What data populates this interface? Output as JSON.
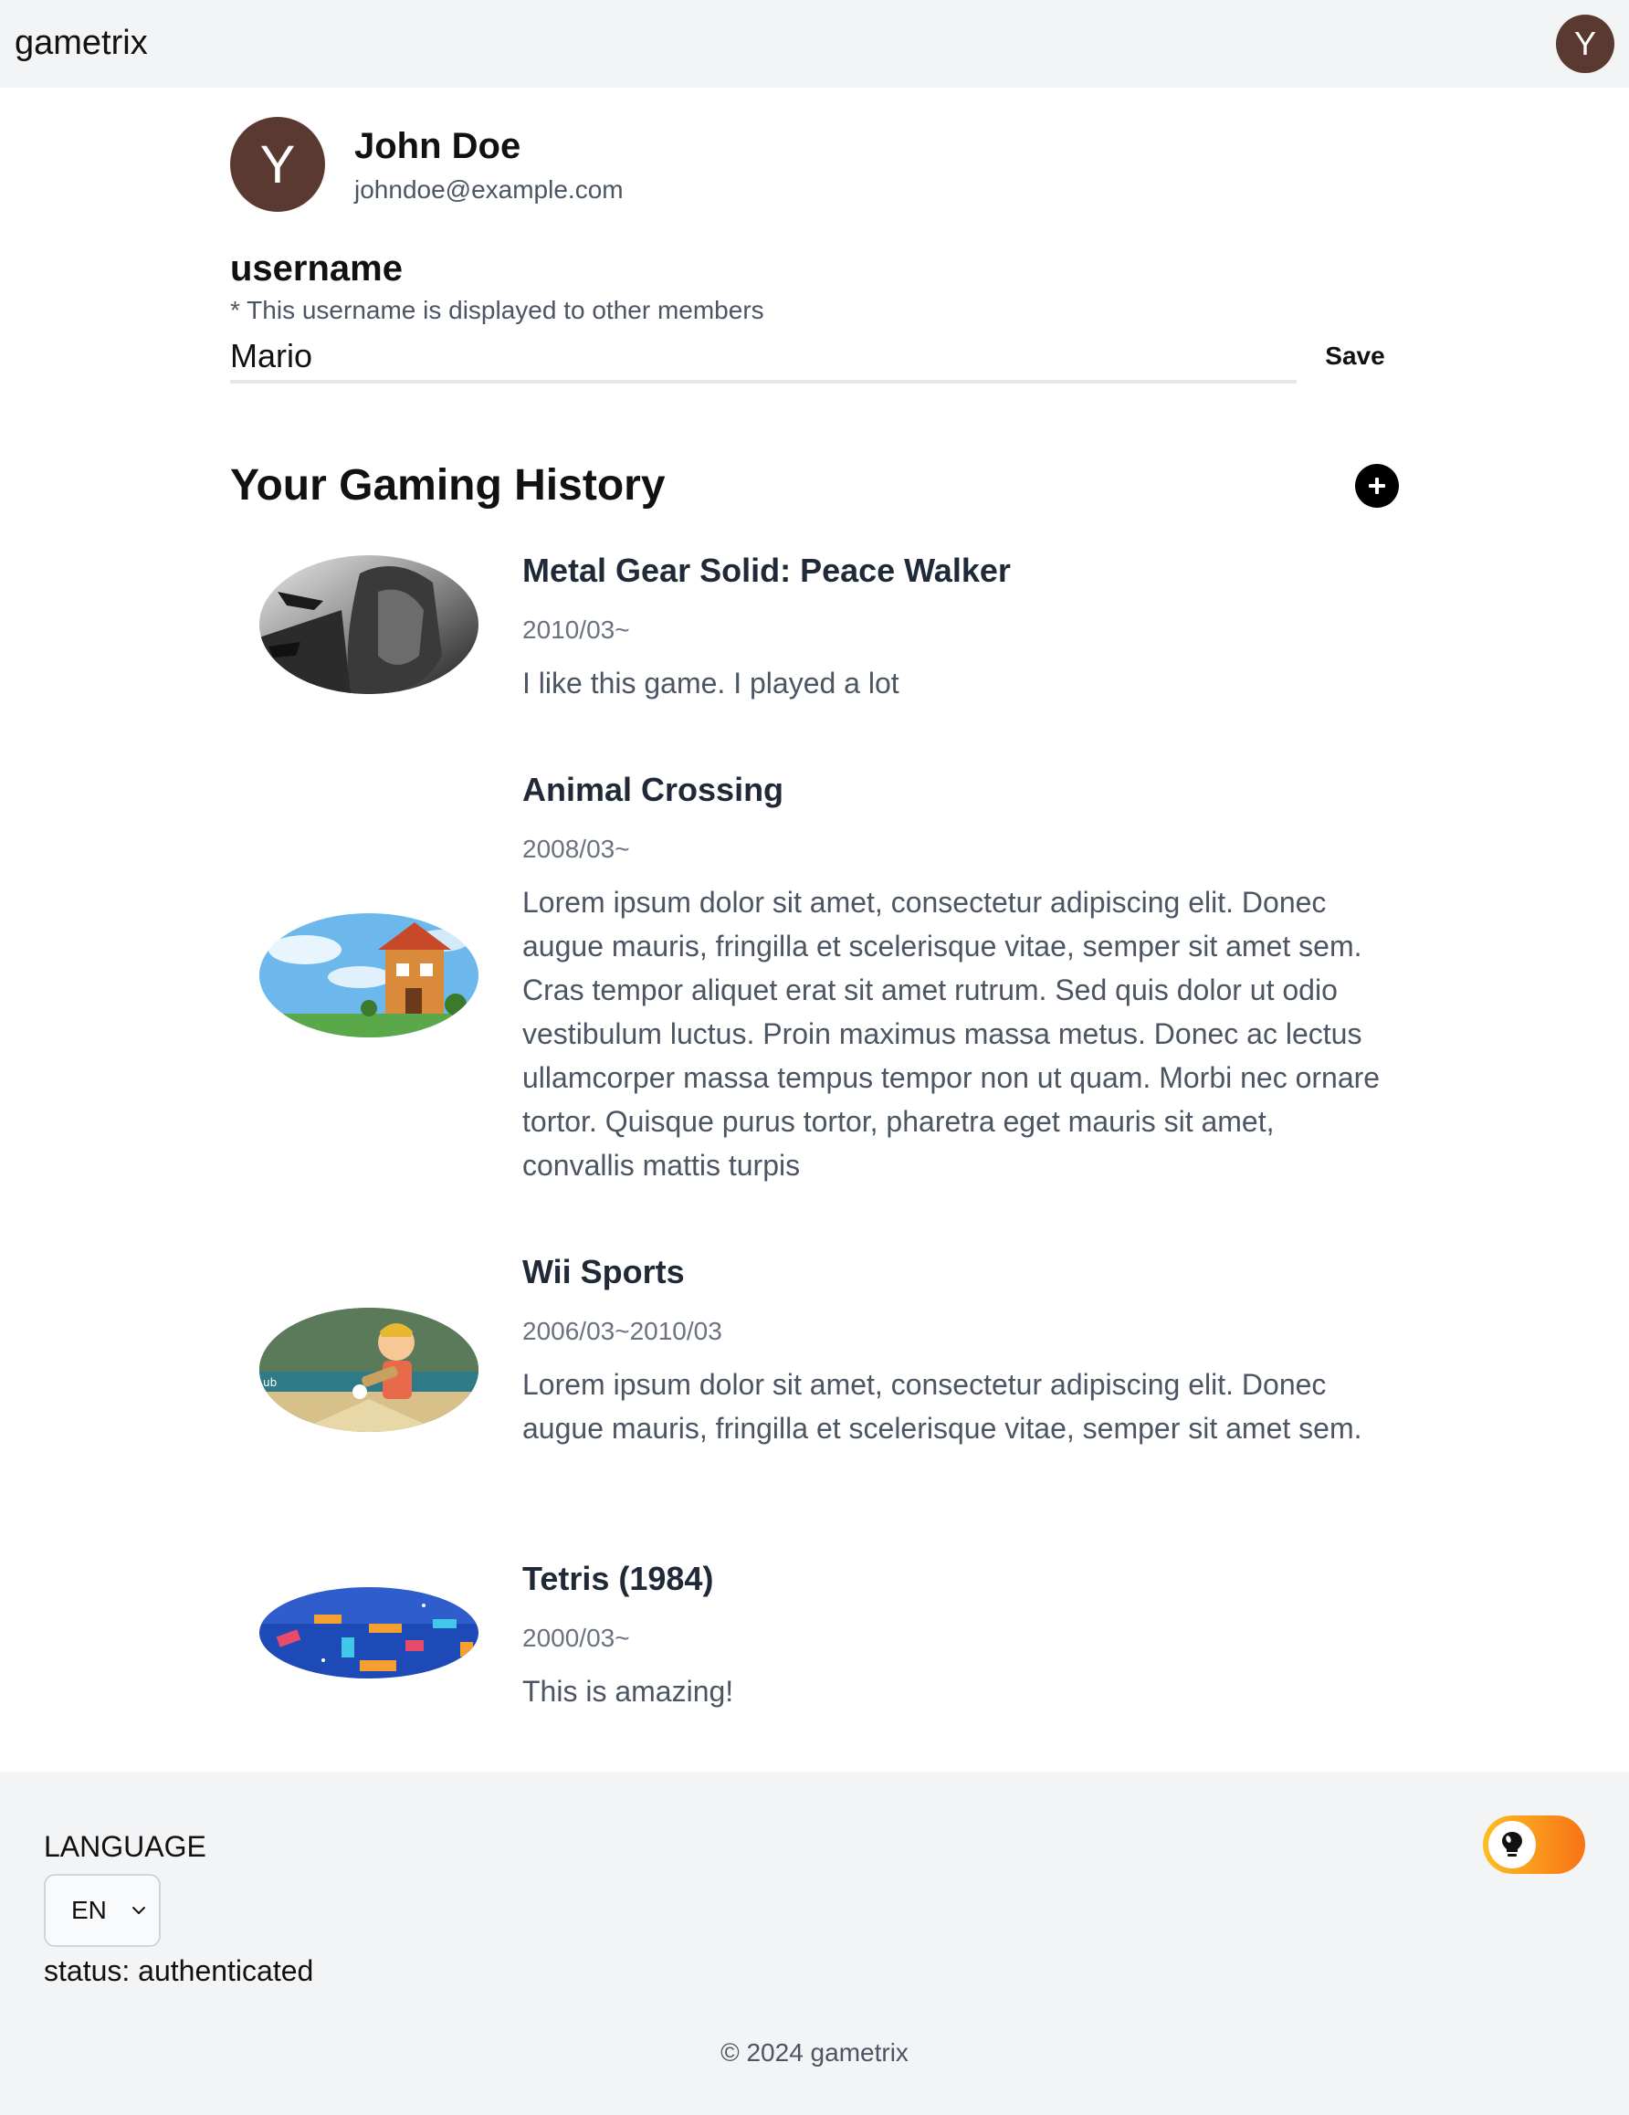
{
  "header": {
    "brand": "gametrix",
    "avatar_letter": "Y"
  },
  "profile": {
    "avatar_letter": "Y",
    "name": "John Doe",
    "email": "johndoe@example.com"
  },
  "username": {
    "heading": "username",
    "note": "* This username is displayed to other members",
    "value": "Mario",
    "save_label": "Save"
  },
  "history": {
    "title": "Your Gaming History",
    "add_icon": "plus-circle-icon",
    "games": [
      {
        "title": "Metal Gear Solid: Peace Walker",
        "date": "2010/03~",
        "description": "I like this game. I played a lot"
      },
      {
        "title": "Animal Crossing",
        "date": "2008/03~",
        "description": "Lorem ipsum dolor sit amet, consectetur adipiscing elit. Donec augue mauris, fringilla et scelerisque vitae, semper sit amet sem. Cras tempor aliquet erat sit amet rutrum. Sed quis dolor ut odio vestibulum luctus. Proin maximus massa metus. Donec ac lectus ullamcorper massa tempus tempor non ut quam. Morbi nec ornare tortor. Quisque purus tortor, pharetra eget mauris sit amet, convallis mattis turpis"
      },
      {
        "title": "Wii Sports",
        "date": "2006/03~2010/03",
        "description": "Lorem ipsum dolor sit amet, consectetur adipiscing elit. Donec augue mauris, fringilla et scelerisque vitae, semper sit amet sem."
      },
      {
        "title": "Tetris (1984)",
        "date": "2000/03~",
        "description": "This is amazing!"
      }
    ]
  },
  "footer": {
    "language_label": "LANGUAGE",
    "language_value": "EN",
    "status": "status: authenticated",
    "copyright": "© 2024 gametrix",
    "theme_toggle_icon": "lightbulb-icon"
  },
  "colors": {
    "avatar": "#5a3a30",
    "header_bg": "#f3f4f6",
    "toggle_start": "#fbbf24",
    "toggle_end": "#f97316"
  }
}
